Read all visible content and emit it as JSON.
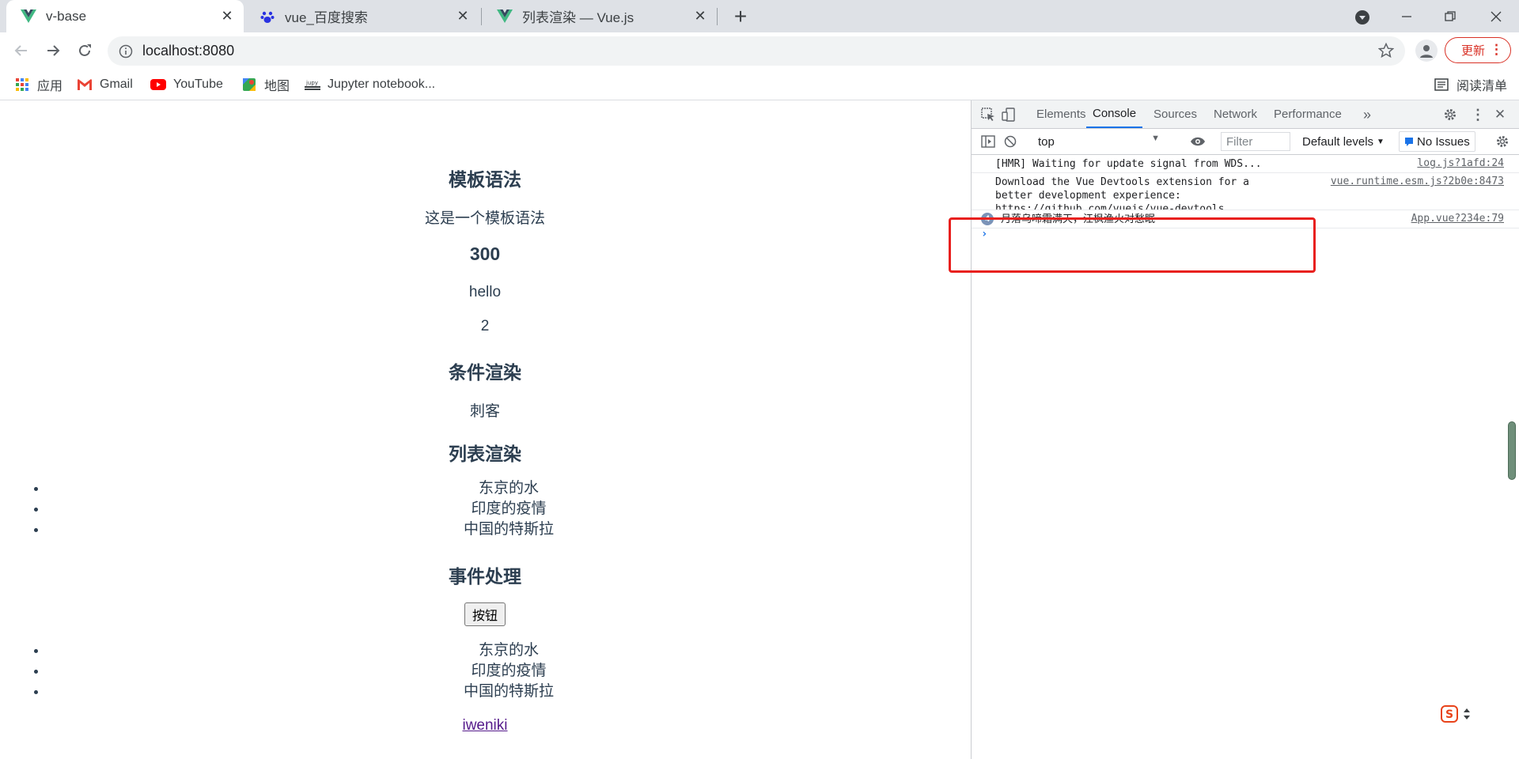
{
  "browser": {
    "tabs": [
      {
        "title": "v-base",
        "icon": "vue-logo-icon",
        "active": true
      },
      {
        "title": "vue_百度搜索",
        "icon": "baidu-paw-icon",
        "active": false
      },
      {
        "title": "列表渲染 — Vue.js",
        "icon": "vue-logo-icon",
        "active": false
      }
    ],
    "address": "localhost:8080",
    "update_label": "更新",
    "bookmarks": [
      {
        "label": "应用",
        "icon": "apps-grid-icon"
      },
      {
        "label": "Gmail",
        "icon": "gmail-icon"
      },
      {
        "label": "YouTube",
        "icon": "youtube-icon"
      },
      {
        "label": "地图",
        "icon": "maps-icon"
      },
      {
        "label": "Jupyter notebook...",
        "icon": "jupyter-icon"
      }
    ],
    "reading_list": "阅读清单"
  },
  "page": {
    "template_heading": "模板语法",
    "template_text": "这是一个模板语法",
    "number": "300",
    "hello": "hello",
    "two": "2",
    "conditional_heading": "条件渲染",
    "conditional_text": "刺客",
    "list_heading": "列表渲染",
    "list_items": [
      "东京的水",
      "印度的疫情",
      "中国的特斯拉"
    ],
    "event_heading": "事件处理",
    "button_label": "按钮",
    "list_items_2": [
      "东京的水",
      "印度的疫情",
      "中国的特斯拉"
    ],
    "link_text": "iweniki"
  },
  "devtools": {
    "tabs": [
      "Elements",
      "Console",
      "Sources",
      "Network",
      "Performance"
    ],
    "active_tab": "Console",
    "context": "top",
    "filter_placeholder": "Filter",
    "levels": "Default levels",
    "issues": "No Issues",
    "messages": [
      {
        "text": "[HMR] Waiting for update signal from WDS...",
        "source": "log.js?1afd:24"
      },
      {
        "text": "Download the Vue Devtools extension for a\nbetter development experience:\nhttps://github.com/vuejs/vue-devtools",
        "source": "vue.runtime.esm.js?2b0e:8473"
      },
      {
        "text": "月落乌啼霜满天，江枫渔火对愁眠",
        "source": "App.vue?234e:79",
        "count": "4"
      }
    ],
    "prompt": "›"
  },
  "colors": {
    "page_text": "#2c3e50",
    "highlight": "#e8201e",
    "accent": "#1a73e8",
    "update": "#d93025"
  }
}
